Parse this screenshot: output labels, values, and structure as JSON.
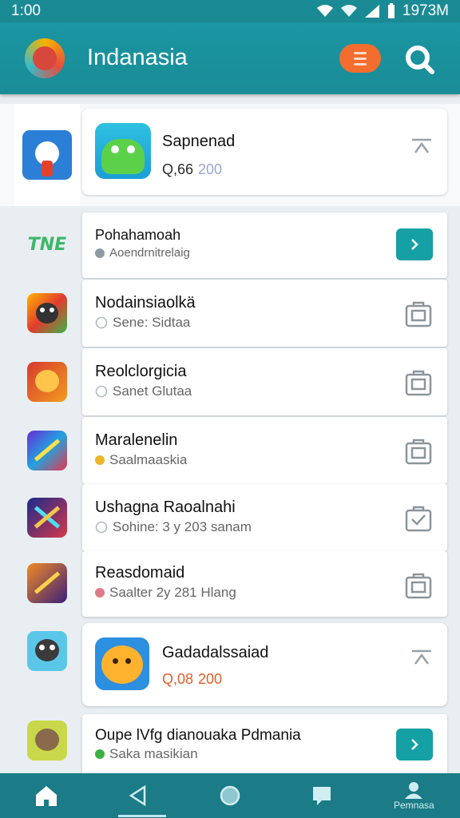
{
  "status": {
    "time": "1:00",
    "clock_right": "1973M"
  },
  "app": {
    "title": "Indanasia"
  },
  "featured_top": {
    "title": "Sapnenad",
    "price": "Q,66",
    "price_alt": "200",
    "price_color": "#2b2b2b",
    "close_icon": "collapse-icon"
  },
  "items": [
    {
      "title": "Pohahamoah",
      "sub": "Aoendrnitrelaig",
      "action": "arrow",
      "side": "TNE",
      "dot": "#8e9aa3"
    },
    {
      "title": "Nodainsiaolkä",
      "sub": "Sene: Sidtaa",
      "action": "bag",
      "dot": "#c9cfd3"
    },
    {
      "title": "Reolclorgicia",
      "sub": "Sanet Glutaa",
      "action": "bag",
      "dot": "#c9cfd3"
    },
    {
      "title": "Maralenelin",
      "sub": "Saalmaaskia",
      "action": "bag",
      "dot": "#f0b429"
    },
    {
      "title": "Ushagna Raoalnahi",
      "sub": "Sohine: 3 y 203 sanam",
      "action": "bag-check",
      "dot": "#c9cfd3"
    },
    {
      "title": "Reasdomaid",
      "sub": "Saalter 2y 281 Hlang",
      "action": "bag",
      "dot": "#e07a86"
    }
  ],
  "featured_bottom": {
    "title": "Gadadalssaiad",
    "price": "Q,08",
    "price_alt": "200",
    "price_color": "#e0602a"
  },
  "last_item": {
    "title": "Oupe lVfg dianouaka Pdmania",
    "sub": "Saka masikian",
    "dot": "#3cb043"
  },
  "nav": {
    "profile_label": "Pemnasa"
  },
  "colors": {
    "accent": "#1a8c97",
    "menu": "#f26d2e",
    "go": "#15a0a6"
  }
}
